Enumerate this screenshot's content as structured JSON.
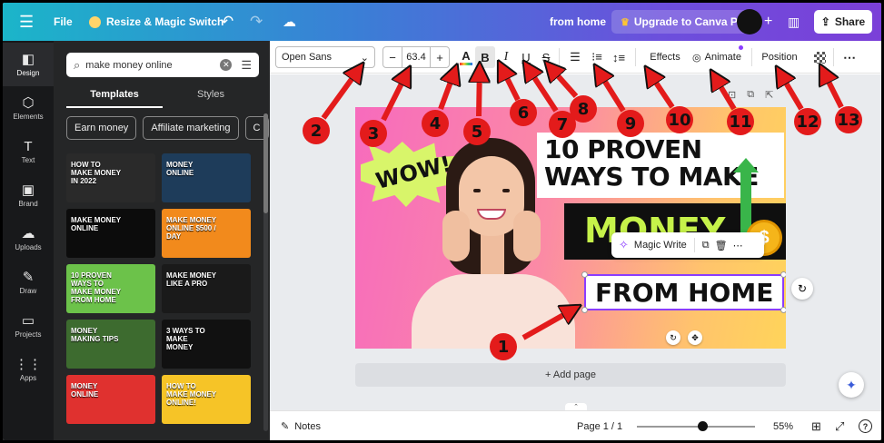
{
  "topbar": {
    "file": "File",
    "resize": "Resize & Magic Switch",
    "title": "from home",
    "upgrade": "Upgrade to Canva Pro",
    "share": "Share"
  },
  "rail": [
    {
      "label": "Design",
      "icon": "layout-icon",
      "glyph": "◧"
    },
    {
      "label": "Elements",
      "icon": "shapes-icon",
      "glyph": "⬡"
    },
    {
      "label": "Text",
      "icon": "text-icon",
      "glyph": "T"
    },
    {
      "label": "Brand",
      "icon": "brand-icon",
      "glyph": "▣"
    },
    {
      "label": "Uploads",
      "icon": "cloud-upload-icon",
      "glyph": "☁"
    },
    {
      "label": "Draw",
      "icon": "pen-icon",
      "glyph": "✎"
    },
    {
      "label": "Projects",
      "icon": "folder-icon",
      "glyph": "▭"
    },
    {
      "label": "Apps",
      "icon": "apps-grid-icon",
      "glyph": "⋮⋮"
    }
  ],
  "panel": {
    "search_value": "make money online",
    "tabs": [
      "Templates",
      "Styles"
    ],
    "chips": [
      "Earn money",
      "Affiliate marketing",
      "C"
    ],
    "thumbnails": [
      {
        "text": "HOW TO MAKE MONEY IN 2022",
        "bg": "#2a2a2a"
      },
      {
        "text": "MONEY ONLINE",
        "bg": "#1e3c5a"
      },
      {
        "text": "MAKE MONEY ONLINE",
        "bg": "#0c0c0c"
      },
      {
        "text": "MAKE MONEY ONLINE $500 / DAY",
        "bg": "#f28a1c"
      },
      {
        "text": "10 PROVEN WAYS TO MAKE MONEY FROM HOME",
        "bg": "#6cc24a"
      },
      {
        "text": "MAKE MONEY LIKE A PRO",
        "bg": "#1a1a1a"
      },
      {
        "text": "MONEY MAKING TIPS",
        "bg": "#3d6b2f"
      },
      {
        "text": "3 WAYS TO MAKE MONEY",
        "bg": "#111111"
      },
      {
        "text": "MONEY ONLINE",
        "bg": "#e0312f"
      },
      {
        "text": "HOW TO MAKE MONEY ONLINE!",
        "bg": "#f6c427"
      }
    ]
  },
  "toolbar": {
    "font": "Open Sans",
    "size": "63.4",
    "minus": "−",
    "plus": "+",
    "color": "A",
    "bold": "B",
    "italic": "I",
    "underline": "U",
    "strike": "S",
    "effects": "Effects",
    "animate": "Animate",
    "position": "Position"
  },
  "canvas": {
    "wow": "WOW!",
    "title": "10 PROVEN WAYS TO MAKE",
    "money": "MONEY",
    "coin": "$",
    "from_home": "FROM HOME",
    "magic_write": "Magic Write"
  },
  "workspace": {
    "add_page": "+ Add page"
  },
  "bottombar": {
    "notes": "Notes",
    "page": "Page 1 / 1",
    "zoom": "55%",
    "zoom_level": 0.55
  },
  "annotations": {
    "color": "#e31b1b",
    "labels": [
      "1",
      "2",
      "3",
      "4",
      "5",
      "6",
      "7",
      "8",
      "9",
      "10",
      "11",
      "12",
      "13"
    ]
  }
}
